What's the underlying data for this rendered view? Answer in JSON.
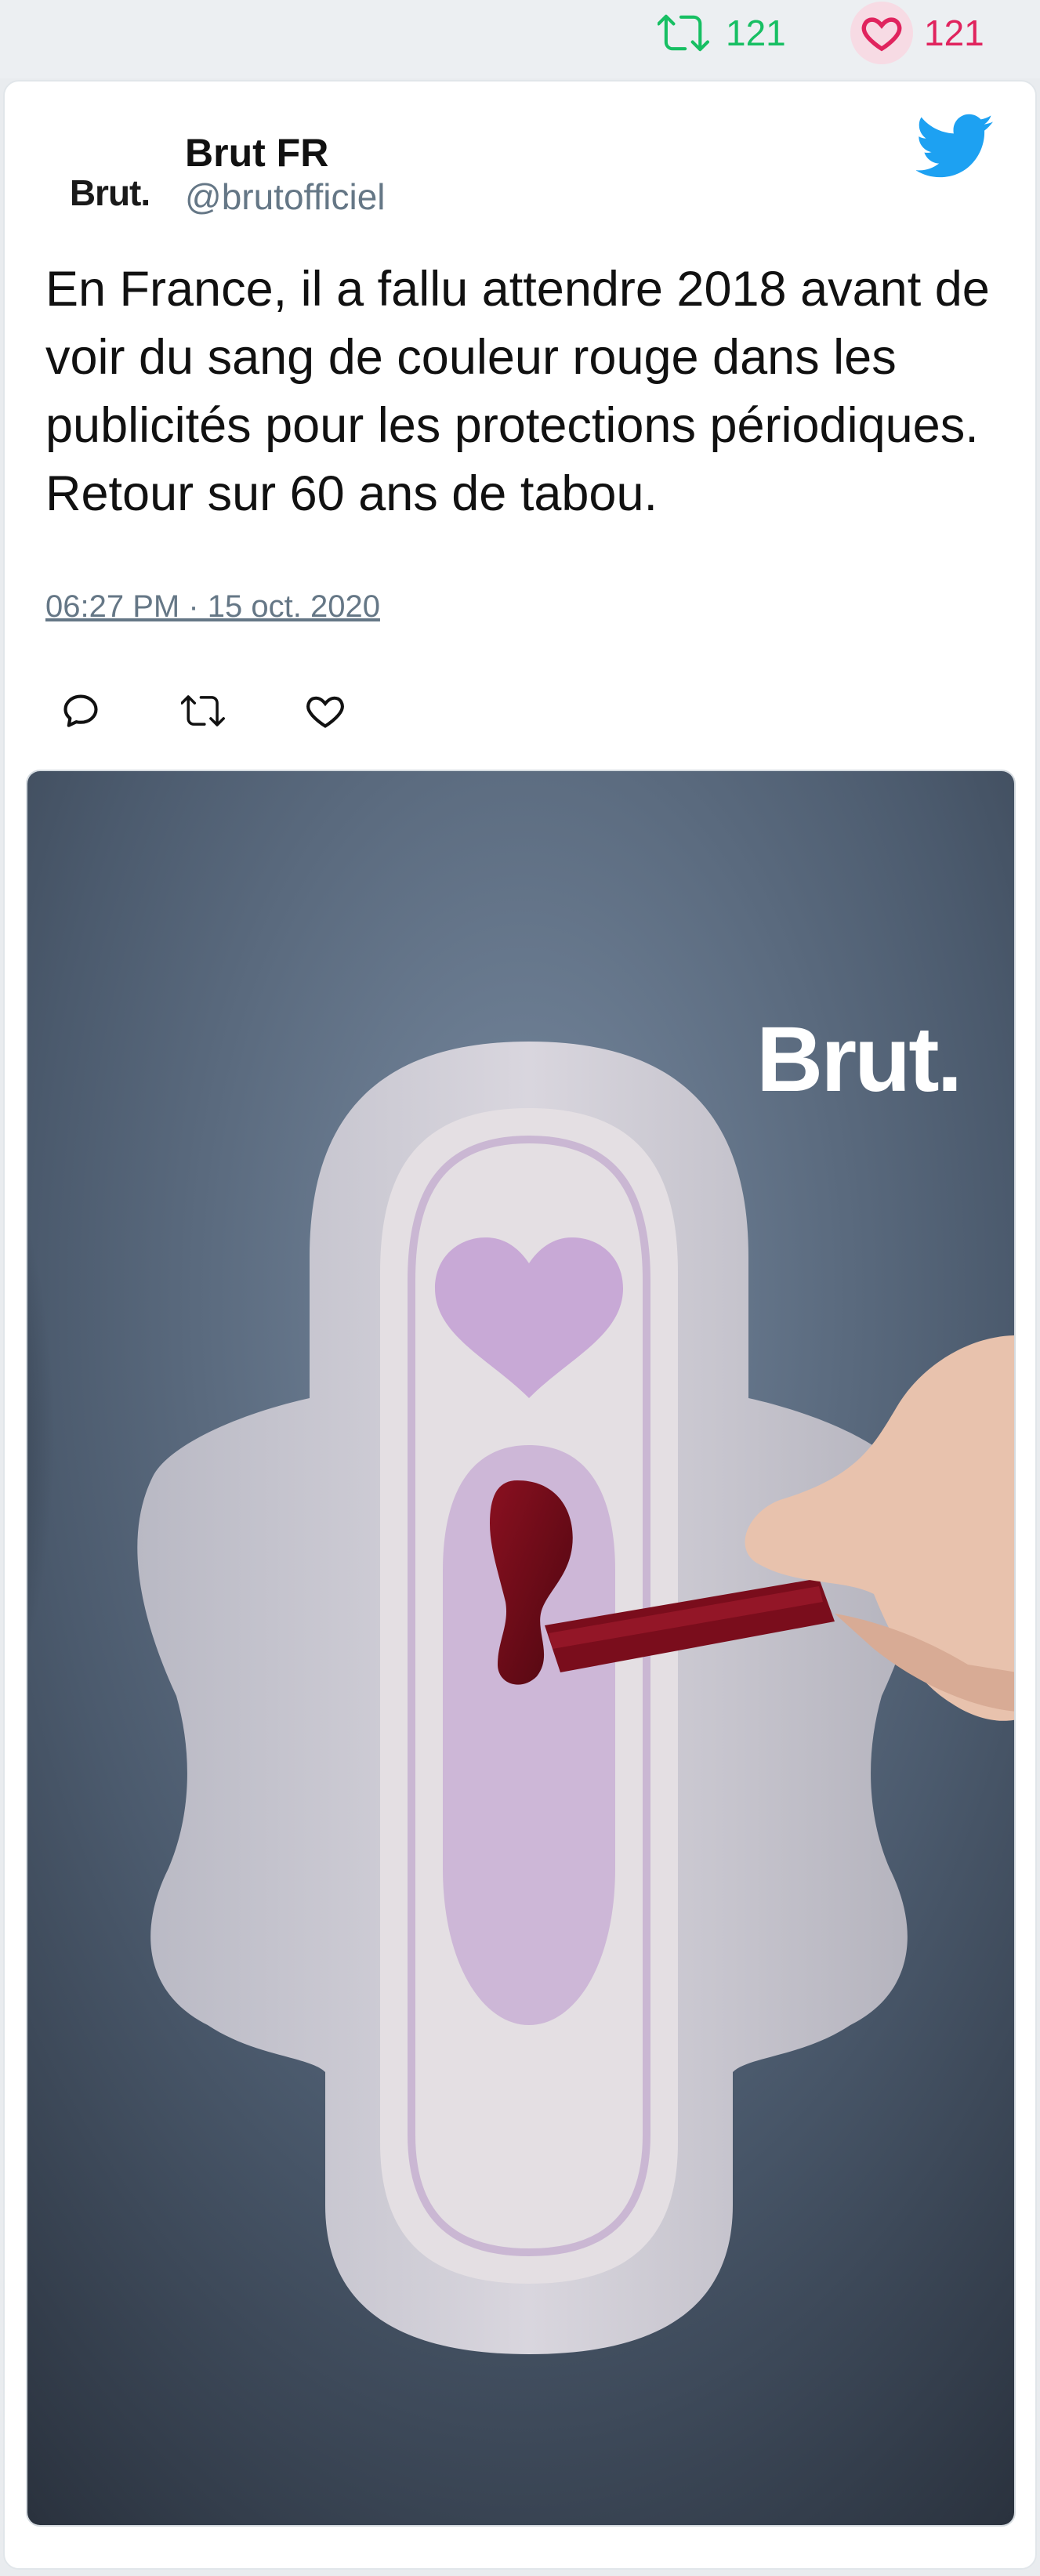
{
  "engagement": {
    "retweet_count": "121",
    "like_count": "121",
    "retweet_color": "#17bf63",
    "like_color": "#e0245e"
  },
  "author": {
    "avatar_text": "Brut.",
    "name": "Brut FR",
    "handle": "@brutofficiel"
  },
  "tweet": {
    "text": "En France, il a fallu attendre 2018 avant de voir du sang de couleur rouge dans les publicités pour les protections périodiques. Retour sur 60 ans de tabou.",
    "timestamp": "06:27 PM · 15 oct. 2020"
  },
  "actions": {
    "reply_icon": "reply-icon",
    "retweet_icon": "retweet-icon",
    "like_icon": "heart-icon"
  },
  "media": {
    "watermark": "Brut."
  },
  "brand": {
    "twitter_blue": "#1da1f2"
  }
}
